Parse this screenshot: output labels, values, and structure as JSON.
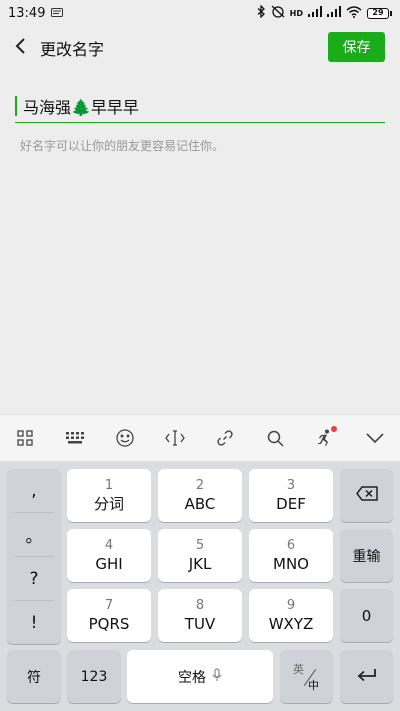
{
  "status": {
    "time": "13:49",
    "network": "HD",
    "battery": "29"
  },
  "header": {
    "title": "更改名字",
    "save_label": "保存"
  },
  "name_field": {
    "value": "马海强🌲早早早",
    "hint": "好名字可以让你的朋友更容易记住你。"
  },
  "keyboard_toolbar": {
    "icons": [
      "grid-icon",
      "keyboard-icon",
      "emoji-icon",
      "cursor-icon",
      "link-icon",
      "search-icon",
      "runner-icon",
      "collapse-icon"
    ]
  },
  "keyboard": {
    "punctuation": [
      ",",
      "。",
      "?",
      "!"
    ],
    "keys": {
      "k1": {
        "num": "1",
        "label": "分词"
      },
      "k2": {
        "num": "2",
        "label": "ABC"
      },
      "k3": {
        "num": "3",
        "label": "DEF"
      },
      "k4": {
        "num": "4",
        "label": "GHI"
      },
      "k5": {
        "num": "5",
        "label": "JKL"
      },
      "k6": {
        "num": "6",
        "label": "MNO"
      },
      "k7": {
        "num": "7",
        "label": "PQRS"
      },
      "k8": {
        "num": "8",
        "label": "TUV"
      },
      "k9": {
        "num": "9",
        "label": "WXYZ"
      }
    },
    "reinput": "重输",
    "zero": "0",
    "symbols": "符",
    "numbers": "123",
    "space": "空格",
    "lang_en": "英",
    "lang_zh": "中"
  },
  "colors": {
    "accent": "#1aad19",
    "notification_dot": "#f23b3b"
  }
}
